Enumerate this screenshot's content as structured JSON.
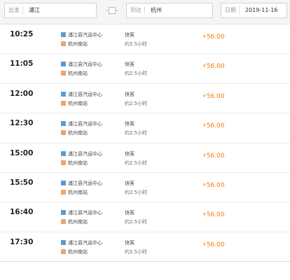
{
  "search": {
    "from_label": "出发",
    "from_value": "浦江",
    "to_label": "到达",
    "to_value": "杭州",
    "date_label": "日期",
    "date_value": "2019-11-16"
  },
  "colors": {
    "price": "#f07a12",
    "start_tag": "#5b9bd5",
    "end_tag": "#f0a36f"
  },
  "schedule": [
    {
      "time": "10:25",
      "from_station": "浦江县汽运中心",
      "to_station": "杭州南站",
      "type": "快客",
      "duration": "约2.5小时",
      "currency": "¥",
      "price": "56.00"
    },
    {
      "time": "11:05",
      "from_station": "浦江县汽运中心",
      "to_station": "杭州南站",
      "type": "快客",
      "duration": "约2.5小时",
      "currency": "¥",
      "price": "56.00"
    },
    {
      "time": "12:00",
      "from_station": "浦江县汽运中心",
      "to_station": "杭州南站",
      "type": "快客",
      "duration": "约2.5小时",
      "currency": "¥",
      "price": "56.00"
    },
    {
      "time": "12:30",
      "from_station": "浦江县汽运中心",
      "to_station": "杭州南站",
      "type": "快客",
      "duration": "约2.5小时",
      "currency": "¥",
      "price": "56.00"
    },
    {
      "time": "15:00",
      "from_station": "浦江县汽运中心",
      "to_station": "杭州南站",
      "type": "快客",
      "duration": "约2.5小时",
      "currency": "¥",
      "price": "56.00"
    },
    {
      "time": "15:50",
      "from_station": "浦江县汽运中心",
      "to_station": "杭州南站",
      "type": "快客",
      "duration": "约2.5小时",
      "currency": "¥",
      "price": "56.00"
    },
    {
      "time": "16:40",
      "from_station": "浦江县汽运中心",
      "to_station": "杭州南站",
      "type": "快客",
      "duration": "约2.5小时",
      "currency": "¥",
      "price": "56.00"
    },
    {
      "time": "17:30",
      "from_station": "浦江县汽运中心",
      "to_station": "杭州南站",
      "type": "快客",
      "duration": "约2.5小时",
      "currency": "¥",
      "price": "56.00"
    }
  ]
}
